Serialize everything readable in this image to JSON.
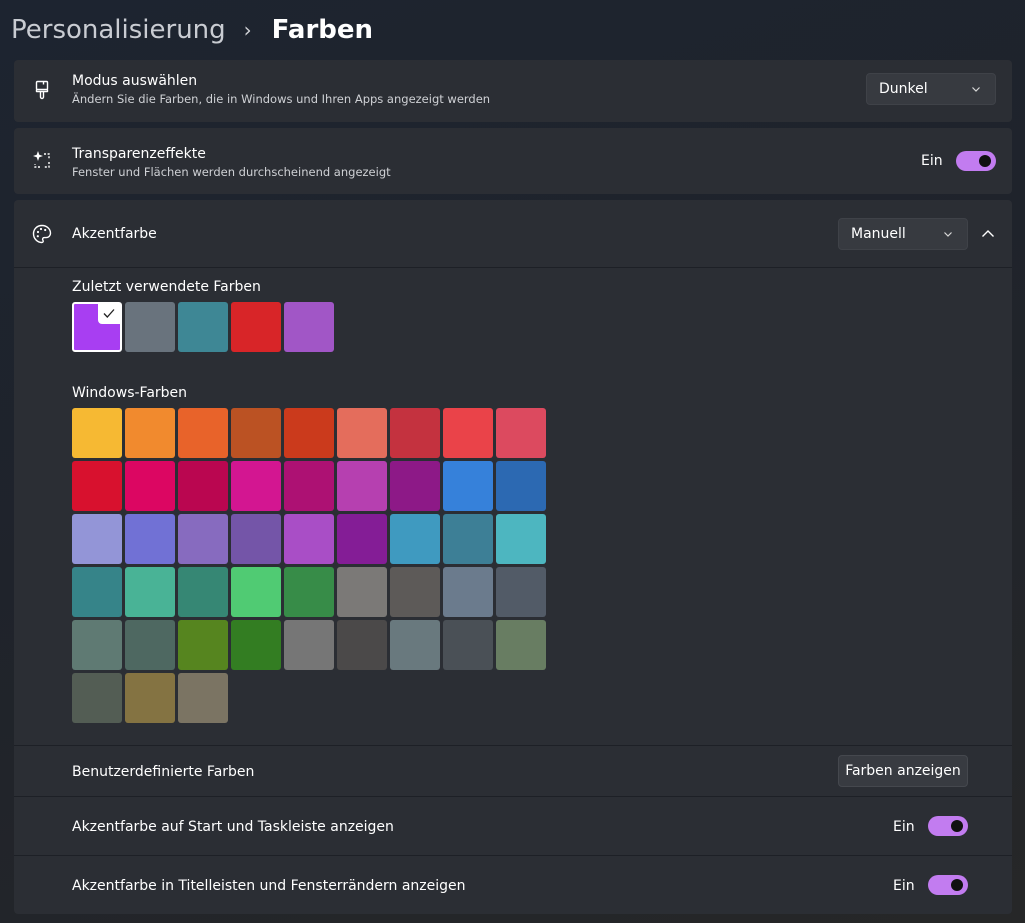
{
  "breadcrumb": {
    "parent": "Personalisierung",
    "separator": "›",
    "current": "Farben"
  },
  "mode": {
    "icon": "paintbrush-icon",
    "title": "Modus auswählen",
    "subtitle": "Ändern Sie die Farben, die in Windows und Ihren Apps angezeigt werden",
    "value": "Dunkel"
  },
  "transparency": {
    "icon": "sparkle-selection-icon",
    "title": "Transparenzeffekte",
    "subtitle": "Fenster und Flächen werden durchscheinend angezeigt",
    "state_label": "Ein",
    "on": true
  },
  "accent": {
    "icon": "palette-icon",
    "title": "Akzentfarbe",
    "value": "Manuell",
    "recent_label": "Zuletzt verwendete Farben",
    "recent_colors": [
      "#a83ef2",
      "#69737d",
      "#3e8795",
      "#d82528",
      "#a156c6"
    ],
    "selected_recent_index": 0,
    "windows_label": "Windows-Farben",
    "windows_colors": [
      [
        "#f6b933",
        "#f18a2e",
        "#e8632a",
        "#bb5223",
        "#cb3a1c",
        "#e46d5c",
        "#c4323f",
        "#ea4349",
        "#dc4a5f"
      ],
      [
        "#d8112e",
        "#dc0662",
        "#ba0650",
        "#d31691",
        "#ad1173",
        "#b640b0",
        "#8d1987",
        "#3681da",
        "#2c69b2"
      ],
      [
        "#9395d7",
        "#7171d5",
        "#876bbf",
        "#7455a8",
        "#a94ec6",
        "#841d96",
        "#3f9ac0",
        "#3d7f96",
        "#4db6c0"
      ],
      [
        "#368489",
        "#49b396",
        "#368774",
        "#50cb73",
        "#378c48",
        "#7b7977",
        "#5d5a58",
        "#6b7b8d",
        "#525b67"
      ],
      [
        "#5f7a73",
        "#4e6861",
        "#56851f",
        "#337d22",
        "#767676",
        "#4b4949",
        "#69797e",
        "#4a5056",
        "#687d62"
      ],
      [
        "#535d54",
        "#847342",
        "#7b7463"
      ]
    ]
  },
  "custom_colors": {
    "label": "Benutzerdefinierte Farben",
    "button": "Farben anzeigen"
  },
  "start_taskbar": {
    "label": "Akzentfarbe auf Start und Taskleiste anzeigen",
    "state_label": "Ein",
    "on": true
  },
  "title_bars": {
    "label": "Akzentfarbe in Titelleisten und Fensterrändern anzeigen",
    "state_label": "Ein",
    "on": true
  },
  "colors": {
    "accent_toggle": "#c27cf0",
    "card_bg": "#2b2e34"
  }
}
